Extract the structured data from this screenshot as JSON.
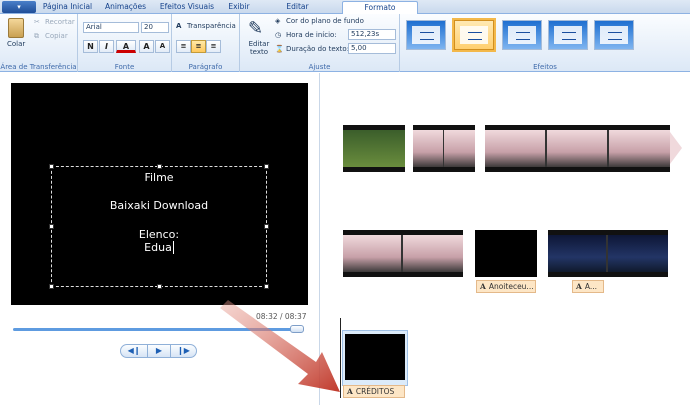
{
  "tabs": [
    "Página Inicial",
    "Animações",
    "Efeitos Visuais",
    "Exibir",
    "Editar",
    "Formato"
  ],
  "active_tab": "Formato",
  "clipboard": {
    "paste": "Colar",
    "cut": "Recortar",
    "copy": "Copiar",
    "label": "Área de Transferência"
  },
  "font": {
    "family": "Arial",
    "size": "20",
    "bold": "N",
    "italic": "I",
    "color": "A",
    "grow": "A",
    "shrink": "A",
    "label": "Fonte"
  },
  "paragraph": {
    "transparency": "Transparência",
    "label": "Parágrafo"
  },
  "adjust": {
    "edit_text": "Editar texto",
    "background": "Cor do plano de fundo",
    "start_label": "Hora de início:",
    "start_value": "512,23s",
    "duration_label": "Duração do texto:",
    "duration_value": "5,00",
    "label": "Ajuste"
  },
  "effects": {
    "label": "Efeitos",
    "selected_index": 1
  },
  "preview": {
    "line1": "Filme",
    "line2": "Baixaki Download",
    "line3": "Elenco:",
    "line4": "Edua",
    "time": "08:32 / 08:37",
    "progress": 0.99
  },
  "storyboard": {
    "caption1": "Anoiteceu...",
    "caption2": "A...",
    "credits": "CRÉDITOS"
  },
  "colors": {
    "accent": "#1e395b",
    "caption_bg": "#fde6c6",
    "arrow": "#c0392b"
  }
}
